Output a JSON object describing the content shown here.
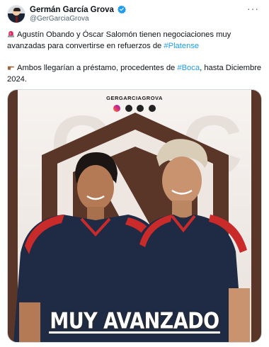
{
  "author": {
    "name": "Germán García Grova",
    "handle": "@GerGarciaGrova"
  },
  "tweet": {
    "para1_text": "Agustín Obando y Óscar Salomón tienen negociaciones muy avanzadas para convertirse en refuerzos de ",
    "para1_hashtag": "#Platense",
    "para2_text": "Ambos llegarían a préstamo, procedentes de ",
    "para2_hashtag": "#Boca",
    "para2_tail": ", hasta Diciembre 2024."
  },
  "media": {
    "watermark": "GERGARCIAGROVA",
    "headline": "MUY AVANZADO"
  },
  "colors": {
    "hashtag": "#1d9bf0",
    "brand_brown": "#5a3628",
    "shirt_navy": "#1f2b44",
    "shirt_red": "#c92a2a"
  },
  "icons": [
    "verified-badge-icon",
    "more-options-icon",
    "siren-emoji-icon",
    "pointing-hand-emoji-icon",
    "instagram-icon",
    "threads-icon",
    "x-icon",
    "tiktok-icon"
  ]
}
